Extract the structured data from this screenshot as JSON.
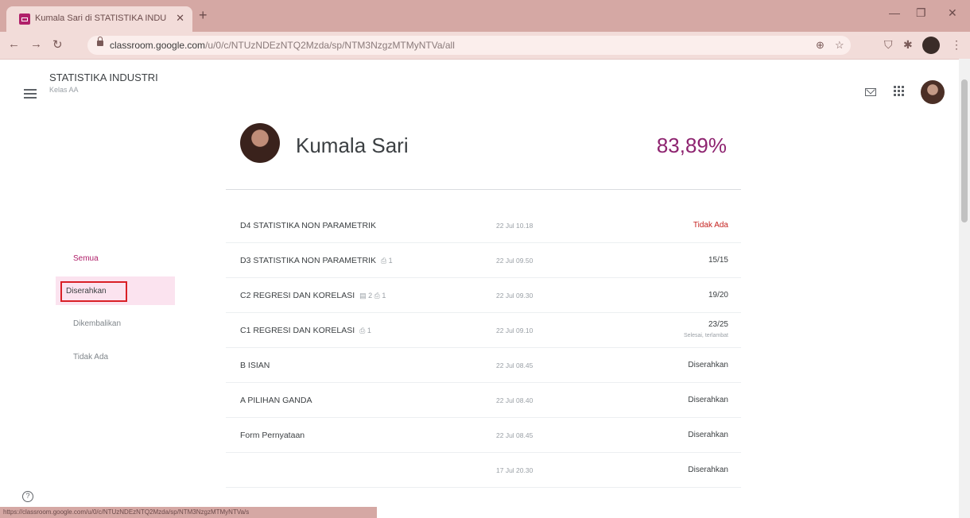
{
  "browser": {
    "tab_title": "Kumala Sari di STATISTIKA INDU",
    "tab_close": "✕",
    "new_tab": "+",
    "url_host": "classroom.google.com",
    "url_path": "/u/0/c/NTUzNDEzNTQ2Mzda/sp/NTM3NzgzMTMyNTVa/all",
    "status_url": "https://classroom.google.com/u/0/c/NTUzNDEzNTQ2Mzda/sp/NTM3NzgzMTMyNTVa/s"
  },
  "class": {
    "title": "STATISTIKA INDUSTRI",
    "subtitle": "Kelas AA"
  },
  "filters": {
    "semua": "Semua",
    "diserahkan": "Diserahkan",
    "dikembalikan": "Dikembalikan",
    "tidak_ada": "Tidak Ada"
  },
  "student": {
    "name": "Kumala Sari",
    "score": "83,89%"
  },
  "assignments": [
    {
      "title": "D4 STATISTIKA NON PARAMETRIK",
      "attachments": "",
      "date": "22 Jul 10.18",
      "status": "Tidak Ada",
      "note": ""
    },
    {
      "title": "D3 STATISTIKA NON PARAMETRIK",
      "attachments": "⎙ 1",
      "date": "22 Jul 09.50",
      "status": "15/15",
      "note": ""
    },
    {
      "title": "C2 REGRESI DAN KORELASI",
      "attachments": "▤ 2  ⎙ 1",
      "date": "22 Jul 09.30",
      "status": "19/20",
      "note": ""
    },
    {
      "title": "C1 REGRESI DAN KORELASI",
      "attachments": "⎙ 1",
      "date": "22 Jul 09.10",
      "status": "23/25",
      "note": "Selesai, terlambat"
    },
    {
      "title": "B ISIAN",
      "attachments": "",
      "date": "22 Jul 08.45",
      "status": "Diserahkan",
      "note": ""
    },
    {
      "title": "A PILIHAN GANDA",
      "attachments": "",
      "date": "22 Jul 08.40",
      "status": "Diserahkan",
      "note": ""
    },
    {
      "title": "Form Pernyataan",
      "attachments": "",
      "date": "22 Jul 08.45",
      "status": "Diserahkan",
      "note": ""
    },
    {
      "title": "",
      "attachments": "",
      "date": "17 Jul 20.30",
      "status": "Diserahkan",
      "note": ""
    }
  ],
  "colors": {
    "accent": "#b0206a",
    "score": "#8e2470",
    "highlight": "#d91f26"
  }
}
